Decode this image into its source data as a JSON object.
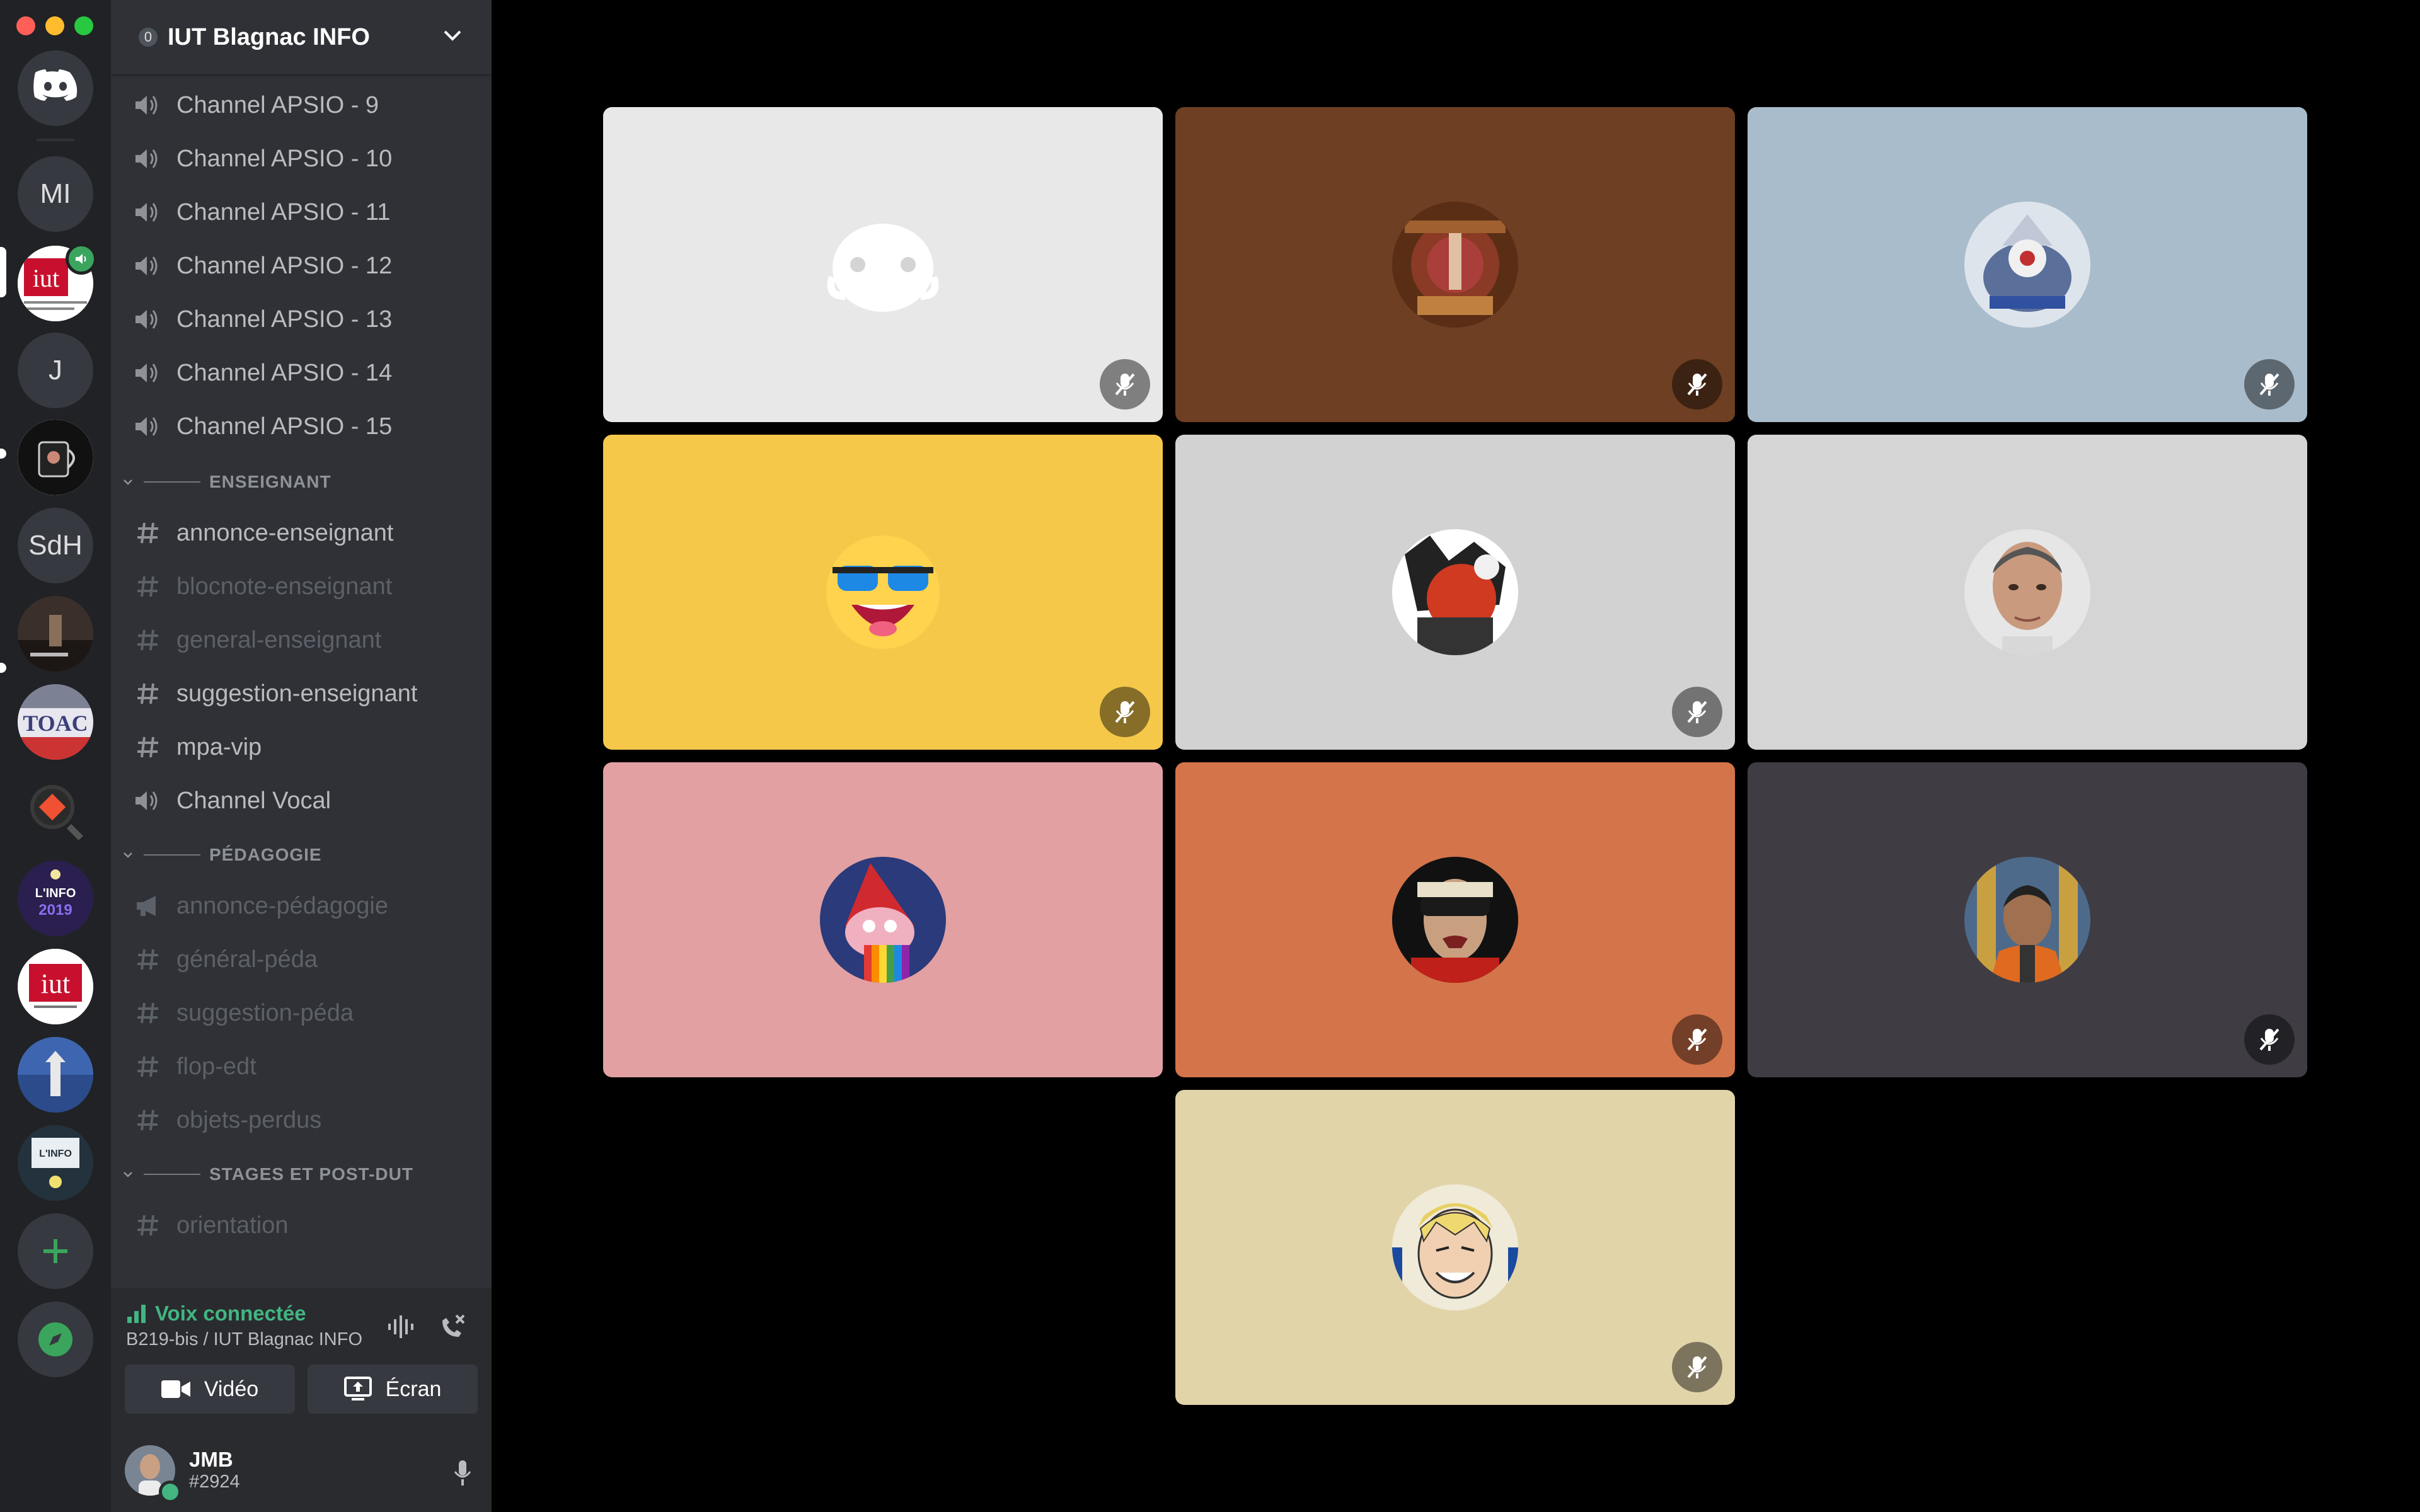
{
  "rail": {
    "servers": [
      {
        "icon": "discord-home-icon"
      },
      {
        "label": "MI"
      },
      {
        "label": "iut",
        "active": true
      },
      {
        "label": "J"
      },
      {
        "label": "mug"
      },
      {
        "label": "SdH"
      },
      {
        "label": "game"
      },
      {
        "label": "TOAC"
      },
      {
        "label": "git"
      },
      {
        "label": "LA NUIT DE L'INFO 2019"
      },
      {
        "label": "iut"
      },
      {
        "label": "photo"
      },
      {
        "label": "LA NUIT DE L'INFO 2020"
      }
    ],
    "add_icon": "plus-icon",
    "explore_icon": "compass-icon"
  },
  "guild": {
    "name": "IUT Blagnac INFO",
    "badge": "0"
  },
  "channels": {
    "top": [
      {
        "name": "Channel APSIO - 9",
        "type": "voice"
      },
      {
        "name": "Channel APSIO - 10",
        "type": "voice"
      },
      {
        "name": "Channel APSIO - 11",
        "type": "voice"
      },
      {
        "name": "Channel APSIO - 12",
        "type": "voice"
      },
      {
        "name": "Channel APSIO - 13",
        "type": "voice"
      },
      {
        "name": "Channel APSIO - 14",
        "type": "voice"
      },
      {
        "name": "Channel APSIO - 15",
        "type": "voice"
      }
    ],
    "categories": [
      {
        "name": "ENSEIGNANT",
        "items": [
          {
            "name": "annonce-enseignant",
            "type": "text",
            "muted": false
          },
          {
            "name": "blocnote-enseignant",
            "type": "text",
            "muted": true
          },
          {
            "name": "general-enseignant",
            "type": "text",
            "muted": true
          },
          {
            "name": "suggestion-enseignant",
            "type": "text",
            "muted": false
          },
          {
            "name": "mpa-vip",
            "type": "text",
            "muted": false
          },
          {
            "name": "Channel Vocal",
            "type": "voice",
            "muted": false
          }
        ]
      },
      {
        "name": "PÉDAGOGIE",
        "items": [
          {
            "name": "annonce-pédagogie",
            "type": "announce",
            "muted": true
          },
          {
            "name": "général-péda",
            "type": "text",
            "muted": true
          },
          {
            "name": "suggestion-péda",
            "type": "text",
            "muted": true
          },
          {
            "name": "flop-edt",
            "type": "text",
            "muted": true
          },
          {
            "name": "objets-perdus",
            "type": "text",
            "muted": true
          }
        ]
      },
      {
        "name": "STAGES ET POST-DUT",
        "items": [
          {
            "name": "orientation",
            "type": "text",
            "muted": true
          }
        ]
      }
    ]
  },
  "voice": {
    "status": "Voix connectée",
    "location": "B219-bis / IUT Blagnac INFO",
    "video_label": "Vidéo",
    "screen_label": "Écran"
  },
  "user": {
    "name": "JMB",
    "tag": "#2924"
  },
  "participants": [
    {
      "bg": "#e8e8e8",
      "avatar": "discord-default-avatar",
      "muted": true
    },
    {
      "bg": "#6e3f22",
      "avatar": "dark-art-avatar",
      "muted": true
    },
    {
      "bg": "#a9bccb",
      "avatar": "robot-character-avatar",
      "muted": true
    },
    {
      "bg": "#f5c84a",
      "avatar": "sunglasses-emoji-avatar",
      "muted": true
    },
    {
      "bg": "#d3d2d3",
      "avatar": "manga-avatar",
      "muted": true
    },
    {
      "bg": "#d6d5d6",
      "avatar": "man-portrait-avatar",
      "muted": false
    },
    {
      "bg": "#e2a0a2",
      "avatar": "rainbow-gnome-avatar",
      "muted": false
    },
    {
      "bg": "#d4744a",
      "avatar": "goggles-man-avatar",
      "muted": true
    },
    {
      "bg": "#3f3c44",
      "avatar": "person-photo-avatar",
      "muted": true
    },
    {
      "bg": "#e2d4a9",
      "avatar": "anime-face-avatar",
      "muted": true
    }
  ]
}
